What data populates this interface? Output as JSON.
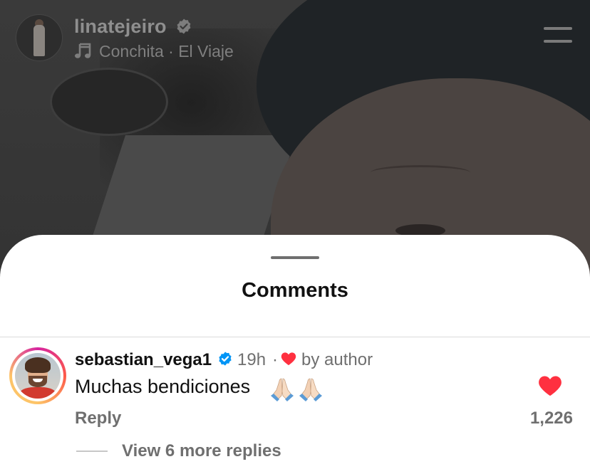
{
  "story": {
    "username": "linatejeiro",
    "song": "Conchita · El Viaje",
    "icons": {
      "verified": "verified-badge-icon",
      "music": "music-note-icon",
      "menu": "menu-icon"
    }
  },
  "sheet": {
    "title": "Comments"
  },
  "comment": {
    "username": "sebastian_vega1",
    "time": "19h",
    "separator": "·",
    "liked_by_author_label": "by author",
    "text": "Muchas bendiciones",
    "emoji": "🙏🏻🙏🏻",
    "reply_label": "Reply",
    "like_count": "1,226",
    "view_replies_label": "View 6 more replies",
    "liked": true
  },
  "colors": {
    "like_red": "#ff3040",
    "verified_blue": "#0095f6",
    "secondary_text": "#6f6f6f"
  }
}
